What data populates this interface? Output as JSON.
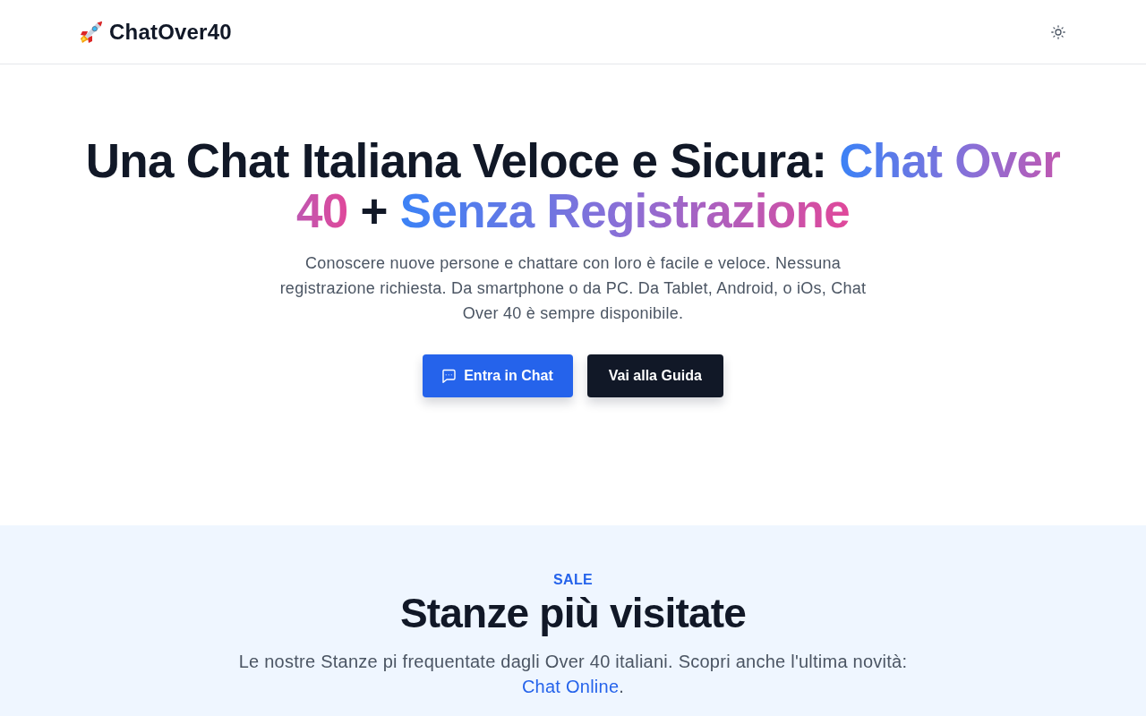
{
  "navbar": {
    "logo": "ChatOver40"
  },
  "hero": {
    "title": [
      {
        "text": "Una Chat Italiana Veloce e Sicura: ",
        "kind": "plain"
      },
      {
        "text": "Chat Over 40",
        "kind": "gradient"
      },
      {
        "text": " + ",
        "kind": "plain"
      },
      {
        "text": "Senza Registrazione",
        "kind": "gradient"
      }
    ],
    "description": "Conoscere nuove persone e chattare con loro è facile e veloce. Nessuna registrazione richiesta. Da smartphone o da PC. Da Tablet, Android, o iOs, Chat Over 40 è sempre disponibile.",
    "buttons": [
      {
        "label": "Entra in Chat",
        "kind": "primary"
      },
      {
        "label": "Vai alla Guida",
        "kind": "dark"
      }
    ]
  },
  "rooms_section": {
    "eyebrow": "SALE",
    "title": "Stanze più visitate",
    "intro": {
      "text": "Le nostre Stanze pi frequentate dagli Over 40 italiani. Scopri anche l'ultima novità: ",
      "link": "Chat Online",
      "after": "."
    }
  }
}
